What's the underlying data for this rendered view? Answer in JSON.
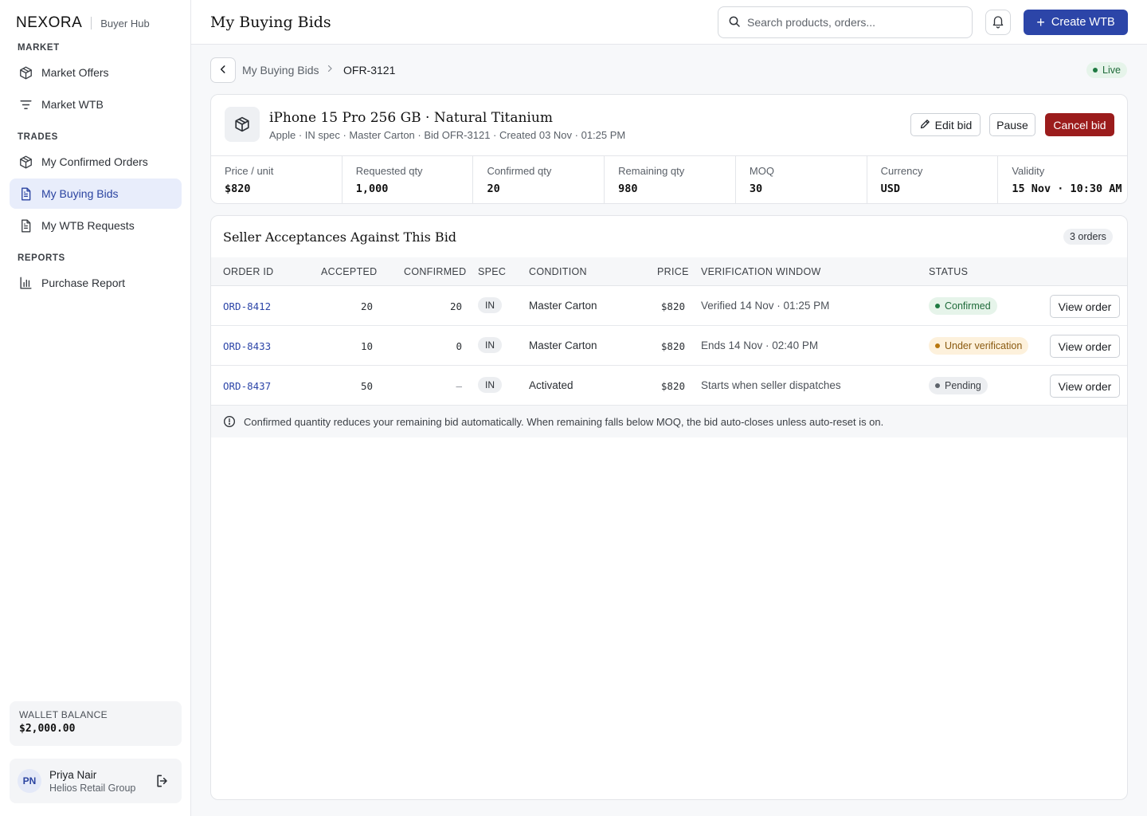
{
  "brand": {
    "logo": "NEXORA",
    "sub": "Buyer Hub"
  },
  "nav": {
    "market_label": "MARKET",
    "trades_label": "TRADES",
    "reports_label": "REPORTS",
    "items": [
      {
        "label": "Market Offers",
        "icon": "cube-icon"
      },
      {
        "label": "Market WTB",
        "icon": "filter-icon"
      },
      {
        "label": "My Confirmed Orders",
        "icon": "cube-icon"
      },
      {
        "label": "My Buying Bids",
        "icon": "document-icon",
        "active": true
      },
      {
        "label": "My WTB Requests",
        "icon": "document-icon"
      },
      {
        "label": "Purchase Report",
        "icon": "bar-chart-icon"
      }
    ]
  },
  "wallet": {
    "label": "WALLET BALANCE",
    "value": "$2,000.00"
  },
  "user": {
    "initials": "PN",
    "name": "Priya Nair",
    "org": "Helios Retail Group"
  },
  "header": {
    "title": "My Buying Bids",
    "search_placeholder": "Search products, orders...",
    "create_label": "Create WTB"
  },
  "breadcrumb": {
    "parent": "My Buying Bids",
    "current": "OFR-3121"
  },
  "status": {
    "live_label": "Live"
  },
  "bid": {
    "title": "iPhone 15 Pro 256 GB · Natural Titanium",
    "meta": "Apple · IN spec · Master Carton · Bid OFR-3121 · Created 03 Nov · 01:25 PM",
    "edit_label": "Edit bid",
    "pause_label": "Pause",
    "cancel_label": "Cancel bid",
    "stats": [
      {
        "label": "Price / unit",
        "value": "$820"
      },
      {
        "label": "Requested qty",
        "value": "1,000"
      },
      {
        "label": "Confirmed qty",
        "value": "20"
      },
      {
        "label": "Remaining qty",
        "value": "980"
      },
      {
        "label": "MOQ",
        "value": "30"
      },
      {
        "label": "Currency",
        "value": "USD"
      },
      {
        "label": "Validity",
        "value": "15 Nov · 10:30 AM"
      }
    ]
  },
  "acceptances": {
    "title": "Seller Acceptances Against This Bid",
    "count_label": "3 orders",
    "columns": [
      "ORDER ID",
      "ACCEPTED",
      "CONFIRMED",
      "SPEC",
      "CONDITION",
      "PRICE",
      "VERIFICATION WINDOW",
      "STATUS"
    ],
    "view_label": "View order",
    "rows": [
      {
        "order_id": "ORD-8412",
        "accepted": "20",
        "confirmed": "20",
        "spec": "IN",
        "condition": "Master Carton",
        "price": "$820",
        "window": "Verified 14 Nov · 01:25 PM",
        "status": "Confirmed"
      },
      {
        "order_id": "ORD-8433",
        "accepted": "10",
        "confirmed": "0",
        "spec": "IN",
        "condition": "Master Carton",
        "price": "$820",
        "window": "Ends 14 Nov · 02:40 PM",
        "status": "Under verification"
      },
      {
        "order_id": "ORD-8437",
        "accepted": "50",
        "confirmed": "–",
        "spec": "IN",
        "condition": "Activated",
        "price": "$820",
        "window": "Starts when seller dispatches",
        "status": "Pending"
      }
    ],
    "note": "Confirmed quantity reduces your remaining bid automatically. When remaining falls below MOQ, the bid auto-closes unless auto-reset is on."
  },
  "colors": {
    "accent": "#2c45a8",
    "danger": "#9b1c1c",
    "success": "#1f6b3a",
    "warning": "#8a5a10"
  }
}
